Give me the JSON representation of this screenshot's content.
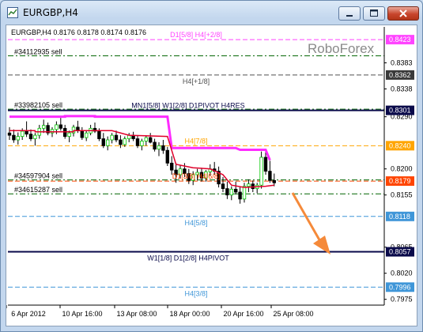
{
  "window": {
    "title": "EURGBP,H4"
  },
  "chart_data": {
    "type": "candlestick",
    "symbol_info": "EURGBP,H4  0.8176 0.8178 0.8174 0.8176",
    "watermark": "RoboForex",
    "y_range": [
      0.7965,
      0.8445
    ],
    "y_ticks": [
      "0.8383",
      "0.8338",
      "0.8290",
      "0.8200",
      "0.8155",
      "0.8065",
      "0.8020",
      "0.7975"
    ],
    "x_ticks": [
      "6 Apr 2012",
      "10 Apr 16:00",
      "13 Apr 08:00",
      "18 Apr 00:00",
      "20 Apr 16:00",
      "25 Apr 08:00"
    ],
    "price_labels": [
      {
        "text": "0.8423",
        "price": 0.8423,
        "color": "#ff44ff",
        "text_color": "#ffffff"
      },
      {
        "text": "0.8362",
        "price": 0.8362,
        "color": "#3a3a3a",
        "text_color": "#ffffff"
      },
      {
        "text": "0.8301",
        "price": 0.8301,
        "color": "#0a0a4a",
        "text_color": "#ffffff"
      },
      {
        "text": "0.8240",
        "price": 0.824,
        "color": "#ffa500",
        "text_color": "#ffffff"
      },
      {
        "text": "0.8179",
        "price": 0.8179,
        "color": "#ff4500",
        "text_color": "#ffffff"
      },
      {
        "text": "0.8118",
        "price": 0.8118,
        "color": "#3f96d8",
        "text_color": "#ffffff"
      },
      {
        "text": "0.8057",
        "price": 0.8057,
        "color": "#0a0a4a",
        "text_color": "#ffffff"
      },
      {
        "text": "0.7996",
        "price": 0.7996,
        "color": "#3f96d8",
        "text_color": "#ffffff"
      }
    ],
    "level_lines": [
      {
        "price": 0.8423,
        "color": "#ff44ff",
        "style": "dash",
        "label": "D1[5/8] H4[+2/8]"
      },
      {
        "price": 0.8362,
        "color": "#505050",
        "style": "dash",
        "label": "H4[+1/8]"
      },
      {
        "price": 0.8301,
        "color": "#0a0a4a",
        "style": "solid",
        "label": "MN1[5/8] W1[2/8] D1PIVOT H4RES"
      },
      {
        "price": 0.824,
        "color": "#ffa500",
        "style": "dash",
        "label": "H4[7/8]"
      },
      {
        "price": 0.8179,
        "color": "#ff4500",
        "style": "dash",
        "label": "D1[3/8] H4[6/8]"
      },
      {
        "price": 0.8118,
        "color": "#3f96d8",
        "style": "dash",
        "label": "H4[5/8]"
      },
      {
        "price": 0.8057,
        "color": "#0a0a4a",
        "style": "solid",
        "label": "W1[1/8] D1[2/8] H4PIVOT"
      },
      {
        "price": 0.7996,
        "color": "#3f96d8",
        "style": "dash",
        "label": "H4[3/8]"
      }
    ],
    "order_lines": [
      {
        "price": 0.8395,
        "text": "#34112935 sell",
        "color": "#006400"
      },
      {
        "price": 0.8303,
        "text": "#33982105 sell",
        "color": "#006400"
      },
      {
        "price": 0.8181,
        "text": "#34597904 sell",
        "color": "#006400"
      },
      {
        "price": 0.8157,
        "text": "#34615287 sell",
        "color": "#006400"
      }
    ],
    "candles": [
      [
        0.8262,
        0.8272,
        0.825,
        0.8258
      ],
      [
        0.8258,
        0.8268,
        0.8245,
        0.825
      ],
      [
        0.825,
        0.8263,
        0.8242,
        0.8256
      ],
      [
        0.8256,
        0.827,
        0.825,
        0.8265
      ],
      [
        0.8265,
        0.8282,
        0.8255,
        0.826
      ],
      [
        0.826,
        0.8268,
        0.8248,
        0.8252
      ],
      [
        0.8252,
        0.8262,
        0.824,
        0.8258
      ],
      [
        0.8258,
        0.8276,
        0.8252,
        0.827
      ],
      [
        0.827,
        0.8285,
        0.8262,
        0.8275
      ],
      [
        0.8275,
        0.828,
        0.8258,
        0.8262
      ],
      [
        0.8262,
        0.8272,
        0.8255,
        0.8268
      ],
      [
        0.8268,
        0.8282,
        0.826,
        0.8276
      ],
      [
        0.8276,
        0.8288,
        0.8266,
        0.827
      ],
      [
        0.827,
        0.8276,
        0.8252,
        0.8256
      ],
      [
        0.8256,
        0.8266,
        0.8246,
        0.8262
      ],
      [
        0.8262,
        0.8276,
        0.8256,
        0.8272
      ],
      [
        0.8272,
        0.8283,
        0.8262,
        0.8266
      ],
      [
        0.8266,
        0.8272,
        0.825,
        0.8254
      ],
      [
        0.8254,
        0.8266,
        0.8248,
        0.8262
      ],
      [
        0.8262,
        0.8276,
        0.8258,
        0.827
      ],
      [
        0.827,
        0.828,
        0.8262,
        0.8265
      ],
      [
        0.8265,
        0.827,
        0.8248,
        0.8252
      ],
      [
        0.8252,
        0.8262,
        0.8236,
        0.824
      ],
      [
        0.824,
        0.8256,
        0.8232,
        0.825
      ],
      [
        0.825,
        0.8262,
        0.8244,
        0.8258
      ],
      [
        0.8258,
        0.8266,
        0.8246,
        0.825
      ],
      [
        0.825,
        0.8258,
        0.8236,
        0.8242
      ],
      [
        0.8242,
        0.8256,
        0.8238,
        0.8252
      ],
      [
        0.8252,
        0.8262,
        0.8246,
        0.8258
      ],
      [
        0.8258,
        0.8264,
        0.8248,
        0.8252
      ],
      [
        0.8252,
        0.8258,
        0.8236,
        0.824
      ],
      [
        0.824,
        0.8252,
        0.8232,
        0.8248
      ],
      [
        0.8248,
        0.8258,
        0.824,
        0.8254
      ],
      [
        0.8254,
        0.8262,
        0.8244,
        0.8246
      ],
      [
        0.8246,
        0.8252,
        0.823,
        0.8234
      ],
      [
        0.8234,
        0.8246,
        0.8222,
        0.824
      ],
      [
        0.824,
        0.825,
        0.8226,
        0.8232
      ],
      [
        0.8232,
        0.8238,
        0.8205,
        0.821
      ],
      [
        0.821,
        0.8222,
        0.819,
        0.8198
      ],
      [
        0.8198,
        0.821,
        0.8176,
        0.819
      ],
      [
        0.819,
        0.8206,
        0.8184,
        0.82
      ],
      [
        0.82,
        0.821,
        0.8186,
        0.8192
      ],
      [
        0.8192,
        0.82,
        0.8174,
        0.818
      ],
      [
        0.818,
        0.8196,
        0.8172,
        0.819
      ],
      [
        0.819,
        0.82,
        0.818,
        0.8194
      ],
      [
        0.8194,
        0.8202,
        0.8178,
        0.8184
      ],
      [
        0.8184,
        0.8198,
        0.8178,
        0.8195
      ],
      [
        0.8195,
        0.8208,
        0.8188,
        0.82
      ],
      [
        0.82,
        0.8212,
        0.819,
        0.8196
      ],
      [
        0.8196,
        0.8204,
        0.8168,
        0.8174
      ],
      [
        0.8174,
        0.8186,
        0.816,
        0.8166
      ],
      [
        0.8166,
        0.8178,
        0.8148,
        0.8155
      ],
      [
        0.8155,
        0.817,
        0.8146,
        0.8165
      ],
      [
        0.8165,
        0.8178,
        0.8156,
        0.816
      ],
      [
        0.816,
        0.817,
        0.814,
        0.8148
      ],
      [
        0.8148,
        0.8176,
        0.8142,
        0.817
      ],
      [
        0.817,
        0.8182,
        0.816,
        0.8174
      ],
      [
        0.8174,
        0.818,
        0.816,
        0.8166
      ],
      [
        0.8166,
        0.8176,
        0.8158,
        0.8172
      ],
      [
        0.8172,
        0.823,
        0.8166,
        0.822
      ],
      [
        0.822,
        0.8232,
        0.819,
        0.8196
      ],
      [
        0.8196,
        0.8214,
        0.8176,
        0.818
      ],
      [
        0.818,
        0.8192,
        0.817,
        0.8176
      ]
    ],
    "indicator_lines": [
      {
        "name": "magenta",
        "color": "#ff2bff",
        "width": 3,
        "points": [
          [
            0,
            0.829
          ],
          [
            13,
            0.829
          ],
          [
            13,
            0.8291
          ],
          [
            20,
            0.8291
          ],
          [
            20,
            0.829
          ],
          [
            37,
            0.829
          ],
          [
            38,
            0.8236
          ],
          [
            53,
            0.8236
          ],
          [
            54,
            0.8233
          ],
          [
            60,
            0.8233
          ],
          [
            61,
            0.8215
          ]
        ]
      },
      {
        "name": "red",
        "color": "#e0002a",
        "width": 1.5,
        "points": [
          [
            0,
            0.8266
          ],
          [
            6,
            0.8266
          ],
          [
            6,
            0.8264
          ],
          [
            15,
            0.8264
          ],
          [
            15,
            0.8266
          ],
          [
            24,
            0.8266
          ],
          [
            28,
            0.8258
          ],
          [
            37,
            0.8256
          ],
          [
            39,
            0.8208
          ],
          [
            43,
            0.8202
          ],
          [
            47,
            0.82
          ],
          [
            50,
            0.819
          ],
          [
            52,
            0.8172
          ],
          [
            55,
            0.8168
          ],
          [
            60,
            0.817
          ],
          [
            62,
            0.8172
          ]
        ]
      }
    ]
  }
}
